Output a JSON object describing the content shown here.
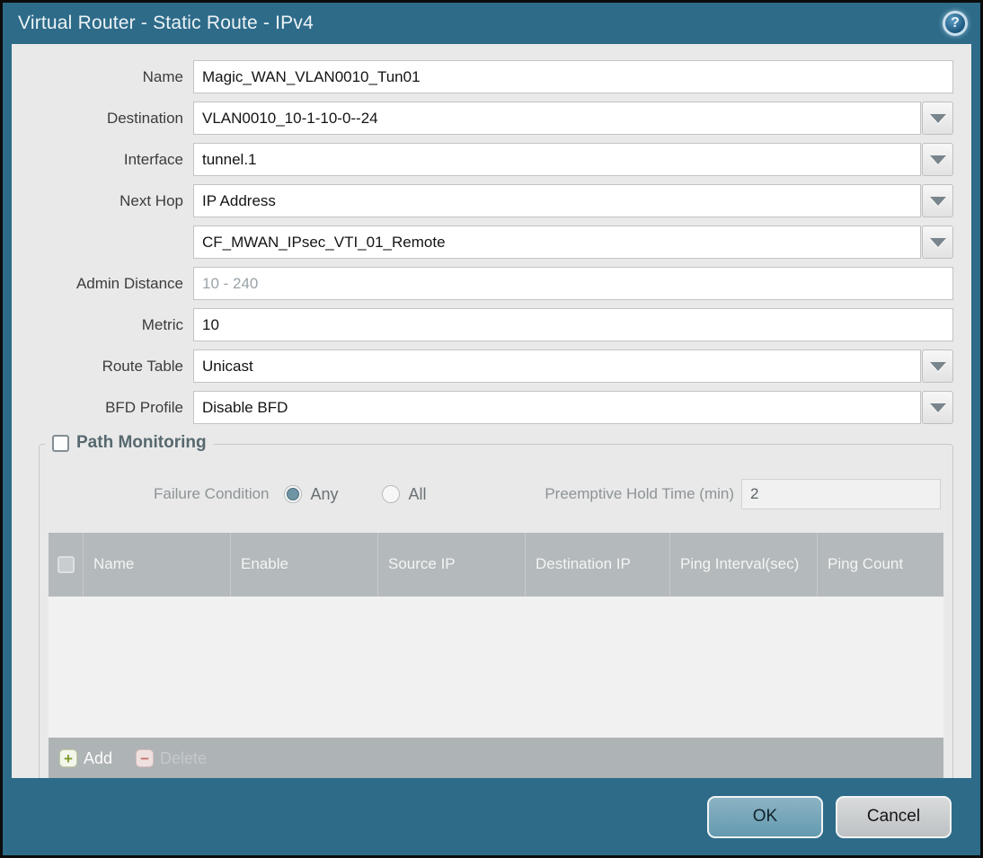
{
  "window": {
    "title": "Virtual Router - Static Route - IPv4",
    "help_icon_glyph": "?"
  },
  "form": {
    "rows": [
      {
        "label": "Name",
        "value": "Magic_WAN_VLAN0010_Tun01"
      },
      {
        "label": "Destination",
        "value": "VLAN0010_10-1-10-0--24"
      },
      {
        "label": "Interface",
        "value": "tunnel.1"
      },
      {
        "label": "Next Hop",
        "value": "IP Address"
      },
      {
        "label": "",
        "value": "CF_MWAN_IPsec_VTI_01_Remote"
      },
      {
        "label": "Admin Distance",
        "placeholder": "10 - 240"
      },
      {
        "label": "Metric",
        "value": "10"
      },
      {
        "label": "Route Table",
        "value": "Unicast"
      },
      {
        "label": "BFD Profile",
        "value": "Disable BFD"
      }
    ]
  },
  "path_monitoring": {
    "title": "Path Monitoring",
    "checkbox_checked": false,
    "failure_condition": {
      "label": "Failure Condition",
      "options": [
        "Any",
        "All"
      ],
      "selected": "Any"
    },
    "preemptive_hold_time": {
      "label": "Preemptive Hold Time (min)",
      "value": "2",
      "disabled": true
    },
    "table": {
      "headers": [
        "Name",
        "Enable",
        "Source IP",
        "Destination IP",
        "Ping Interval(sec)",
        "Ping Count"
      ],
      "rows": []
    },
    "toolbar": {
      "add_label": "Add",
      "add_icon_glyph": "+",
      "delete_label": "Delete",
      "delete_icon_glyph": "−",
      "delete_disabled": true
    }
  },
  "footer": {
    "ok_label": "OK",
    "cancel_label": "Cancel"
  },
  "colors": {
    "titlebar": "#2d6b89",
    "panel_bg": "#e9e9e9",
    "table_header_bg": "#b4b9bb",
    "ok_button": "#6fa1b5",
    "add_icon_green": "#7f9c2e",
    "delete_icon_red": "#c4746f"
  }
}
